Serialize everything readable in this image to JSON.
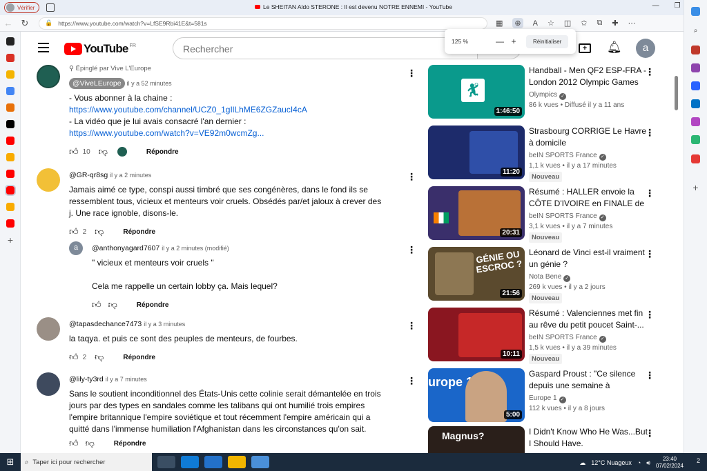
{
  "browser": {
    "profile_label": "Vérifier",
    "tab_title": "Le SHEITAN Aldo STERONE : Il est devenu NOTRE ENNEMI - YouTube",
    "url": "https://www.youtube.com/watch?v=LfSE9Rbi41E&t=581s",
    "zoom": {
      "level": "125 %",
      "reset_label": "Réinitialiser"
    }
  },
  "youtube": {
    "region": "FR",
    "search_placeholder": "Rechercher",
    "account_initial": "a"
  },
  "comments": [
    {
      "pinned_label": "Épinglé par Vive L'Europe",
      "handle": "@ViveLEurope",
      "time": "il y a 52 minutes",
      "lines": [
        "- Vous abonner à la chaine :",
        "https://www.youtube.com/channel/UCZ0_1gIlLhME6ZGZaucI4cA",
        "- La vidéo que je lui avais consacré l'an dernier :",
        "https://www.youtube.com/watch?v=VE92m0wcmZg..."
      ],
      "likes": "10",
      "reply": "Répondre"
    },
    {
      "handle": "@GR-qr8sg",
      "time": "il y a 2 minutes",
      "text": "Jamais aimé ce type, conspi aussi timbré que ses congénères, dans le fond ils se ressemblent tous, vicieux et menteurs voir cruels. Obsédés par/et jaloux à crever des j. Une race ignoble, disons-le.",
      "likes": "2",
      "reply": "Répondre"
    },
    {
      "handle": "@anthonyagard7607",
      "time": "il y a 2 minutes (modifié)",
      "avatar_letter": "a",
      "line1": "\" vicieux et menteurs voir cruels \"",
      "line2": "Cela me rappelle un certain lobby ça. Mais lequel?",
      "reply": "Répondre"
    },
    {
      "handle": "@tapasdechance7473",
      "time": "il y a 3 minutes",
      "text": "la taqya. et puis ce sont des peuples de menteurs, de fourbes.",
      "likes": "2",
      "reply": "Répondre"
    },
    {
      "handle": "@lily-ty3rd",
      "time": "il y a 7 minutes",
      "text": "Sans le soutient inconditionnel des États-Unis cette colinie serait démantelée en trois jours par des types en sandales comme les talibans qui ont humilié trois empires l'empire britannique l'empire soviétique et tout récemment l'empire américain qui a quitté dans l'immense humiliation l'Afghanistan dans les circonstances qu'on sait.",
      "reply": "Répondre"
    }
  ],
  "recommendations": [
    {
      "title": "Handball - Men QF2 ESP-FRA - London 2012 Olympic Games",
      "channel": "Olympics",
      "views": "86 k vues",
      "when": "Diffusé il y a 11 ans",
      "duration": "1:46:50",
      "badge": "",
      "thumb_color": "#0a9a8c"
    },
    {
      "title": "Strasbourg CORRIGE Le Havre à domicile",
      "channel": "beIN SPORTS France",
      "views": "1,1 k vues",
      "when": "il y a 17 minutes",
      "duration": "11:20",
      "badge": "Nouveau",
      "thumb_color": "#1d2b6b"
    },
    {
      "title": "Résumé : HALLER envoie la CÔTE D'IVOIRE en FINALE de l...",
      "channel": "beIN SPORTS France",
      "views": "3,1 k vues",
      "when": "il y a 7 minutes",
      "duration": "20:31",
      "badge": "Nouveau",
      "thumb_color": "#3a2f6b"
    },
    {
      "title": "Léonard de Vinci est-il vraiment un génie ?",
      "channel": "Nota Bene",
      "views": "269 k vues",
      "when": "il y a 2 jours",
      "duration": "21:56",
      "badge": "Nouveau",
      "thumb_color": "#5b4a2e"
    },
    {
      "title": "Résumé : Valenciennes met fin au rêve du petit poucet Saint-...",
      "channel": "beIN SPORTS France",
      "views": "1,5 k vues",
      "when": "il y a 39 minutes",
      "duration": "10:11",
      "badge": "Nouveau",
      "thumb_color": "#8a1620"
    },
    {
      "title": "Gaspard Proust : \"Ce silence depuis une semaine à l'Élysée,...",
      "channel": "Europe 1",
      "views": "112 k vues",
      "when": "il y a 8 jours",
      "duration": "5:00",
      "badge": "",
      "thumb_color": "#1a66c9"
    },
    {
      "title": "I Didn't Know Who He Was...But I Should Have.",
      "channel": "",
      "views": "",
      "when": "",
      "duration": "",
      "badge": "",
      "thumb_color": "#2a1f1a"
    }
  ],
  "thumb_texts": {
    "genie": "GÉNIE OU ESCROC ?",
    "europe1": "urope 1",
    "magnus": "Magnus?"
  },
  "taskbar": {
    "search_placeholder": "Taper ici pour rechercher",
    "weather": "12°C  Nuageux",
    "time": "23:40",
    "date": "07/02/2024",
    "notifications": "2"
  }
}
